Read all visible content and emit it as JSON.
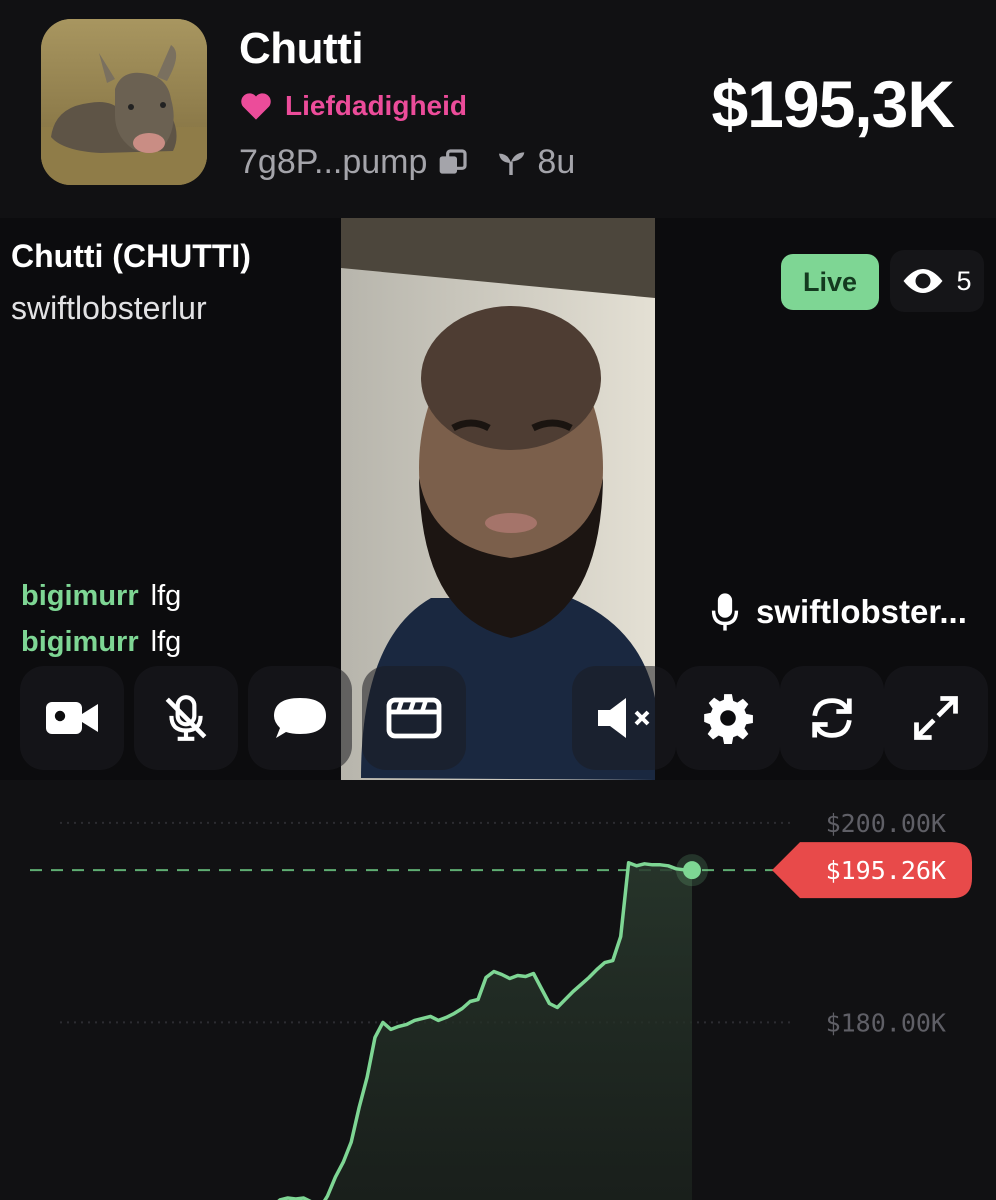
{
  "header": {
    "name": "Chutti",
    "charity_label": "Liefdadigheid",
    "contract": "7g8P...pump",
    "age": "8u",
    "market_cap": "$195,3K"
  },
  "stream": {
    "title": "Chutti (CHUTTI)",
    "host": "swiftlobsterlur",
    "live_label": "Live",
    "viewer_count": "5",
    "speaker": "swiftlobster...",
    "chat": [
      {
        "user": "bigimurr",
        "message": "lfg"
      },
      {
        "user": "bigimurr",
        "message": "lfg"
      }
    ],
    "controls": [
      "camera-icon",
      "mic-off-icon",
      "chat-bubble-icon",
      "clapperboard-icon",
      "volume-muted-icon",
      "gear-icon",
      "refresh-icon",
      "expand-icon"
    ]
  },
  "colors": {
    "accent_green": "#7ed694",
    "charity_pink": "#ec4c9a",
    "price_red": "#e84a4a",
    "background": "#111113"
  },
  "chart_data": {
    "type": "line",
    "ylabel": "",
    "yticks": [
      "$200.00K",
      "$180.00K"
    ],
    "ylim": [
      162.2,
      204.3
    ],
    "current_price": 195.26,
    "current_price_label": "$195.26K",
    "x": [
      0,
      1,
      2,
      3,
      4,
      5,
      6,
      7,
      8,
      9,
      10,
      11,
      12,
      13,
      14,
      15,
      16,
      17,
      18,
      19,
      20,
      21,
      22,
      23,
      24,
      25,
      26,
      27,
      28,
      29,
      30,
      31,
      32,
      33,
      34,
      35,
      36,
      37,
      38,
      39,
      40,
      41,
      42,
      43,
      44,
      45,
      46,
      47,
      48,
      49,
      50,
      51,
      52,
      53,
      54,
      55,
      56,
      57,
      58,
      59,
      60
    ],
    "values": [
      161.5,
      162.2,
      162.4,
      162.3,
      162.4,
      162.0,
      161.3,
      162.6,
      164.5,
      166.0,
      168.0,
      171.5,
      174.5,
      178.5,
      180.0,
      179.3,
      179.6,
      179.8,
      180.2,
      180.4,
      180.6,
      180.2,
      180.5,
      180.9,
      181.4,
      182.1,
      182.3,
      184.5,
      185.1,
      184.8,
      184.4,
      184.7,
      184.6,
      184.9,
      183.4,
      181.9,
      181.5,
      182.3,
      183.1,
      183.8,
      184.5,
      185.3,
      186.0,
      186.2,
      188.6,
      196.0,
      195.7,
      195.9,
      195.8,
      195.8,
      195.7,
      195.4,
      195.3,
      195.26,
      null,
      null,
      null,
      null,
      null,
      null,
      null
    ],
    "grid": "dotted horizontal",
    "fill": "area under line"
  }
}
